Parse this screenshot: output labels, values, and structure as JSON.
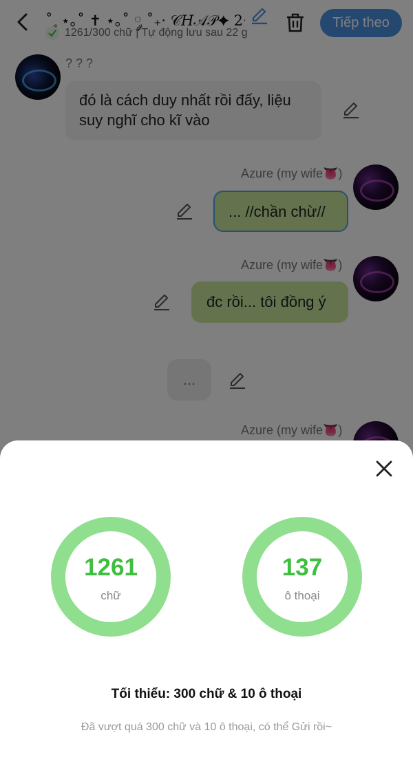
{
  "header": {
    "title": "˚ ༘ ⋆｡˚ ✝︎ ⋆｡˚ ༘ ˚₊· 𝒞𝐻𝒜𝒫✦ 2·₊˚ ༘ ⋆...",
    "status": "1261/300 chữ | Tự động lưu sau 22 g",
    "next_label": "Tiếp theo"
  },
  "chat": {
    "left_name": "? ? ?",
    "left_message": "đó là cách duy nhất rồi đấy, liệu suy nghĩ cho kĩ vào",
    "right_name": "Azure (my wife👅)",
    "msg1": "... //chần chừ//",
    "msg2": "đc rồi... tôi đồng ý",
    "placeholder": "..."
  },
  "stats": {
    "words_value": "1261",
    "words_label": "chữ",
    "dialogs_value": "137",
    "dialogs_label": "ô thoại",
    "minimum": "Tối thiểu: 300 chữ & 10 ô thoại",
    "note": "Đã vượt quá 300 chữ và 10 ô thoại, có thể Gửi rồi~"
  },
  "colors": {
    "accent": "#4a90e2",
    "ring": "#8fdf8f",
    "ring_text": "#3fbe3f",
    "bubble_green": "#c9e69a"
  }
}
